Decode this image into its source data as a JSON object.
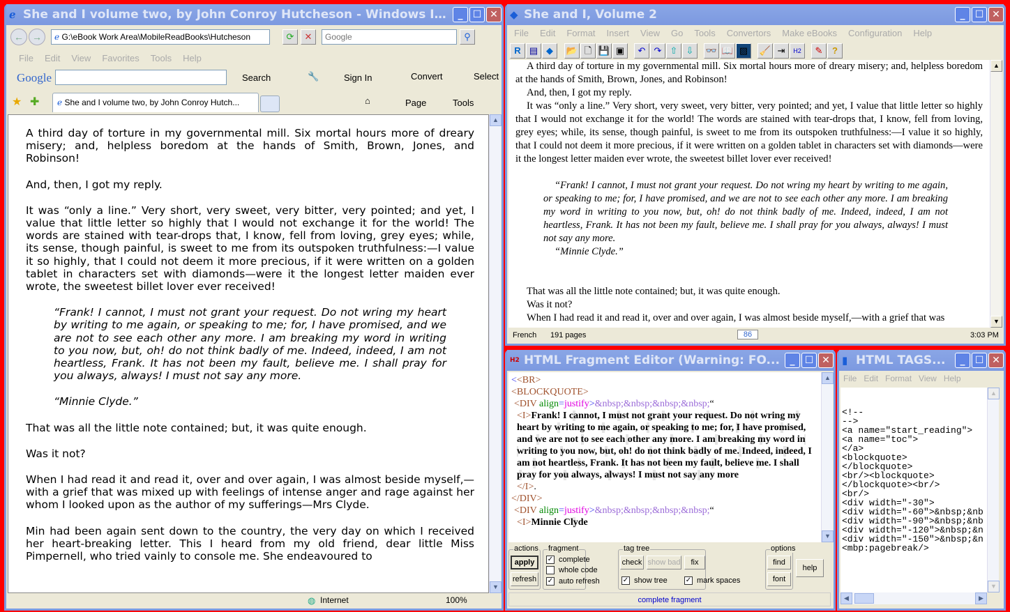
{
  "ie": {
    "title": "She and I volume two, by John Conroy Hutcheson - Windows Int...",
    "address": "G:\\eBook Work Area\\MobileReadBooks\\Hutcheson",
    "search_placeholder": "Google",
    "menu": [
      "File",
      "Edit",
      "View",
      "Favorites",
      "Tools",
      "Help"
    ],
    "google_label": "Google",
    "search_btn": "Search",
    "sign_in": "Sign In",
    "convert": "Convert",
    "select": "Select",
    "tab_title": "She and I volume two, by John Conroy Hutch...",
    "page_btn": "Page",
    "tools_btn": "Tools",
    "status_zone": "Internet",
    "zoom": "100%",
    "paragraphs": [
      "A third day of torture in my governmental mill. Six mortal hours more of dreary misery; and, helpless boredom at the hands of Smith, Brown, Jones, and Robinson!",
      "And, then, I got my reply.",
      "It was “only a line.” Very short, very sweet, very bitter, very pointed; and yet, I value that little letter so highly that I would not exchange it for the world! The words are stained with tear-drops that, I know, fell from loving, grey eyes; while, its sense, though painful, is sweet to me from its outspoken truthfulness:—I value it so highly, that I could not deem it more precious, if it were written on a golden tablet in characters set with diamonds—were it the longest letter maiden ever wrote, the sweetest billet lover ever received!"
    ],
    "quote": "“Frank! I cannot, I must not grant your request. Do not wring my heart by writing to me again, or speaking to me; for, I have promised, and we are not to see each other any more. I am breaking my word in writing to you now, but, oh! do not think badly of me. Indeed, indeed, I am not heartless, Frank. It has not been my fault, believe me. I shall pray for you always, always! I must not say any more.",
    "signature": "“Minnie Clyde.”",
    "paragraphs2": [
      "That was all the little note contained; but, it was quite enough.",
      "Was it not?",
      "When I had read it and read it, over and over again, I was almost beside myself,—with a grief that was mixed up with feelings of intense anger and rage against her whom I looked upon as the author of my sufferings—Mrs Clyde.",
      "Min had been again sent down to the country, the very day on which I received her heart-breaking letter. This I heard from my old friend, dear little Miss Pimpernell, who tried vainly to console me. She endeavoured to"
    ]
  },
  "editor": {
    "title": "She and I, Volume 2",
    "menu": [
      "File",
      "Edit",
      "Format",
      "Insert",
      "View",
      "Go",
      "Tools",
      "Convertors",
      "Make eBooks",
      "Configuration",
      "Help"
    ],
    "p1": "A third day of torture in my governmental mill. Six mortal hours more of dreary misery; and, helpless boredom at the hands of Smith, Brown, Jones, and Robinson!",
    "p2": "And, then, I got my reply.",
    "p3": "It was “only a line.” Very short, very sweet, very bitter, very pointed; and yet, I value that little letter so highly that I would not exchange it for the world! The words are stained with tear-drops that, I know, fell from loving, grey eyes; while, its sense, though painful, is sweet to me from its outspoken truthfulness:—I value it so highly, that I could not deem it more precious, if it were written on a golden tablet in characters set with diamonds—were it the longest letter maiden ever wrote, the sweetest billet lover ever received!",
    "quote": "“Frank! I cannot, I must not grant your request. Do not wring my heart by writing to me again, or speaking to me; for, I have promised, and we are not to see each other any more. I am breaking my word in writing to you now, but, oh! do not think badly of me. Indeed, indeed, I am not heartless, Frank. It has not been my fault, believe me. I shall pray for you always, always! I must not say any more.",
    "sig": "“Minnie Clyde.”",
    "p4": "That was all the little note contained; but, it was quite enough.",
    "p5": "Was it not?",
    "p6": "When I had read it and read it, over and over again, I was almost beside myself,—with a grief that was",
    "status": {
      "language": "French",
      "pages": "191 pages",
      "page": "86",
      "time": "3:03 PM"
    }
  },
  "fragment": {
    "title": "HTML Fragment Editor (Warning: FO...",
    "code": {
      "br": "<BR>",
      "bq": "<BLOCKQUOTE>",
      "div_open": "<DIV ",
      "attr": "align",
      "eq": "=",
      "val": "justify",
      "gt": ">",
      "nbsp": "&nbsp;&nbsp;&nbsp;&nbsp;",
      "ldq": "“",
      "i_open": "<I>",
      "frank": "Frank! I cannot, I must not grant your request. Do not wring my heart by writing to me again, or speaking to me; for, I have promised, and we are not to see each other any more. I am breaking my word in writing to you now, but, oh! do not think badly of me. Indeed, indeed, I am not heartless, Frank. It has not been my fault, believe me. I shall pray for you always, always! I must not say any more",
      "i_close": "</I>",
      "period": ".",
      "div_close": "</DIV>",
      "minnie": "Minnie Clyde"
    },
    "groups": {
      "actions": "actions",
      "fragment": "fragment",
      "tagtree": "tag tree",
      "options": "options"
    },
    "buttons": {
      "apply": "apply",
      "refresh": "refresh",
      "check": "check",
      "show_bad": "show bad",
      "fix": "fix",
      "find": "find",
      "font": "font",
      "help": "help"
    },
    "checks": {
      "complete": "complete",
      "whole_code": "whole code",
      "auto_refresh": "auto refresh",
      "show_tree": "show tree",
      "mark_spaces": "mark spaces"
    },
    "status": "complete fragment"
  },
  "tags": {
    "title": "HTML TAGS...",
    "menu": [
      "File",
      "Edit",
      "Format",
      "View",
      "Help"
    ],
    "lines": [
      "<!--",
      "-->",
      "<a name=\"start_reading\">",
      "<a name=\"toc\">",
      "</a>",
      "<blockquote>",
      "</blockquote>",
      "<br/><blockquote>",
      "</blockquote><br/>",
      "<br/>",
      "<div width=\"-30\">",
      "<div width=\"-60\">&nbsp;&nb",
      "<div width=\"-90\">&nbsp;&nb",
      "<div width=\"-120\">&nbsp;&n",
      "<div width=\"-150\">&nbsp;&n",
      "<mbp:pagebreak/>"
    ]
  }
}
